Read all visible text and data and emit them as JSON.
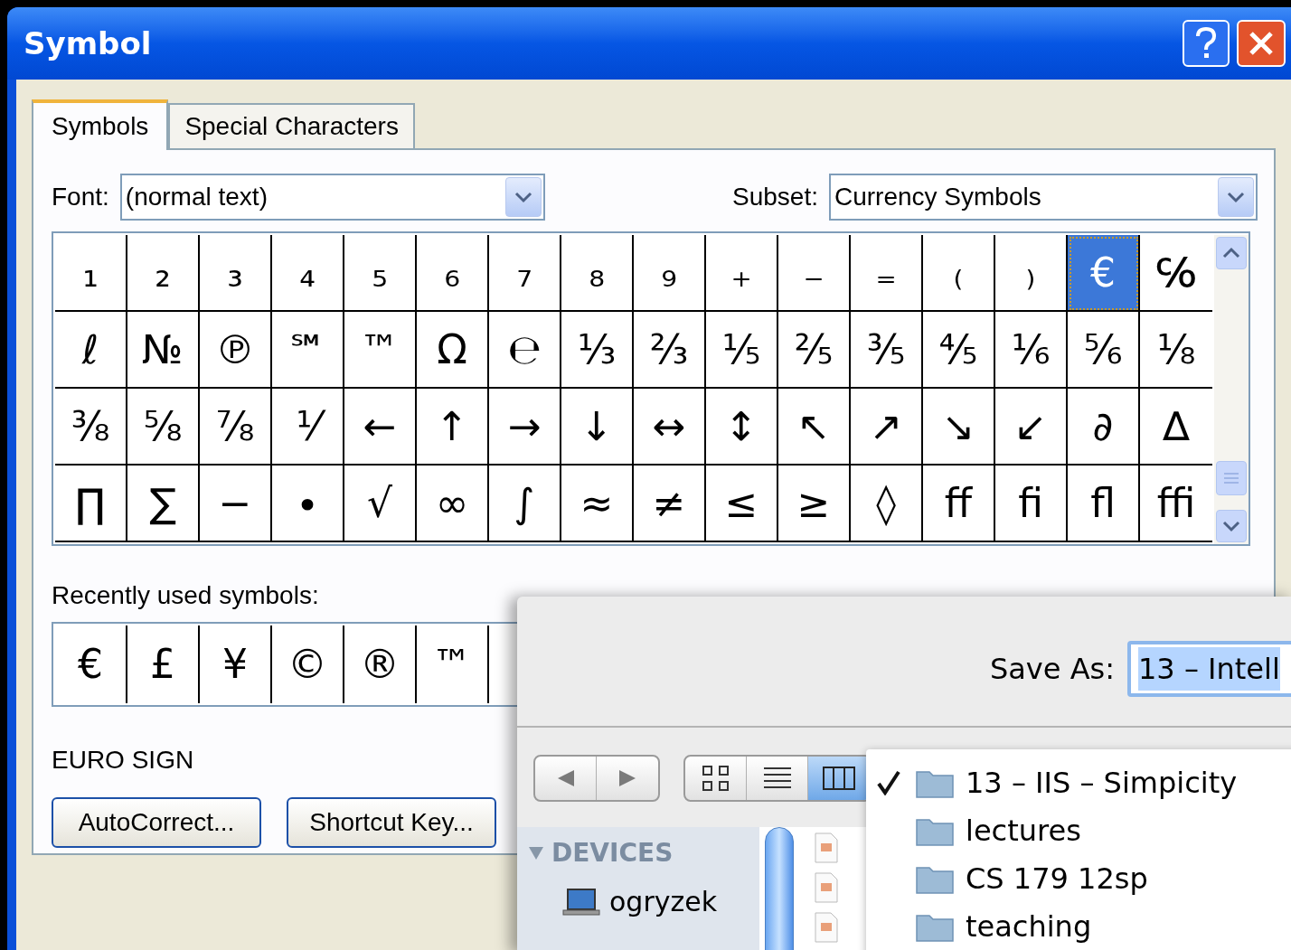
{
  "window": {
    "title": "Symbol"
  },
  "tabs": [
    {
      "label": "Symbols",
      "selected": true
    },
    {
      "label": "Special Characters",
      "selected": false
    }
  ],
  "font": {
    "label": "Font:",
    "value": "(normal text)"
  },
  "subset": {
    "label": "Subset:",
    "value": "Currency Symbols"
  },
  "grid": [
    [
      {
        "char": "₁",
        "selected": false
      },
      {
        "char": "₂",
        "selected": false
      },
      {
        "char": "₃",
        "selected": false
      },
      {
        "char": "₄",
        "selected": false
      },
      {
        "char": "₅",
        "selected": false
      },
      {
        "char": "₆",
        "selected": false
      },
      {
        "char": "₇",
        "selected": false
      },
      {
        "char": "₈",
        "selected": false
      },
      {
        "char": "₉",
        "selected": false
      },
      {
        "char": "₊",
        "selected": false
      },
      {
        "char": "₋",
        "selected": false
      },
      {
        "char": "₌",
        "selected": false
      },
      {
        "char": "₍",
        "selected": false
      },
      {
        "char": "₎",
        "selected": false
      },
      {
        "char": "€",
        "selected": true
      },
      {
        "char": "℅",
        "selected": false
      }
    ],
    [
      {
        "char": "ℓ",
        "selected": false
      },
      {
        "char": "№",
        "selected": false
      },
      {
        "char": "℗",
        "selected": false
      },
      {
        "char": "℠",
        "selected": false
      },
      {
        "char": "™",
        "selected": false
      },
      {
        "char": "Ω",
        "selected": false
      },
      {
        "char": "℮",
        "selected": false
      },
      {
        "char": "⅓",
        "selected": false
      },
      {
        "char": "⅔",
        "selected": false
      },
      {
        "char": "⅕",
        "selected": false
      },
      {
        "char": "⅖",
        "selected": false
      },
      {
        "char": "⅗",
        "selected": false
      },
      {
        "char": "⅘",
        "selected": false
      },
      {
        "char": "⅙",
        "selected": false
      },
      {
        "char": "⅚",
        "selected": false
      },
      {
        "char": "⅛",
        "selected": false
      }
    ],
    [
      {
        "char": "⅜",
        "selected": false
      },
      {
        "char": "⅝",
        "selected": false
      },
      {
        "char": "⅞",
        "selected": false
      },
      {
        "char": "⅟",
        "selected": false
      },
      {
        "char": "←",
        "selected": false
      },
      {
        "char": "↑",
        "selected": false
      },
      {
        "char": "→",
        "selected": false
      },
      {
        "char": "↓",
        "selected": false
      },
      {
        "char": "↔",
        "selected": false
      },
      {
        "char": "↕",
        "selected": false
      },
      {
        "char": "↖",
        "selected": false
      },
      {
        "char": "↗",
        "selected": false
      },
      {
        "char": "↘",
        "selected": false
      },
      {
        "char": "↙",
        "selected": false
      },
      {
        "char": "∂",
        "selected": false
      },
      {
        "char": "∆",
        "selected": false
      }
    ],
    [
      {
        "char": "∏",
        "selected": false
      },
      {
        "char": "∑",
        "selected": false
      },
      {
        "char": "−",
        "selected": false
      },
      {
        "char": "∙",
        "selected": false
      },
      {
        "char": "√",
        "selected": false
      },
      {
        "char": "∞",
        "selected": false
      },
      {
        "char": "∫",
        "selected": false
      },
      {
        "char": "≈",
        "selected": false
      },
      {
        "char": "≠",
        "selected": false
      },
      {
        "char": "≤",
        "selected": false
      },
      {
        "char": "≥",
        "selected": false
      },
      {
        "char": "◊",
        "selected": false
      },
      {
        "char": "ﬀ",
        "selected": false
      },
      {
        "char": "ﬁ",
        "selected": false
      },
      {
        "char": "ﬂ",
        "selected": false
      },
      {
        "char": "ﬃ",
        "selected": false
      }
    ]
  ],
  "recent": {
    "label": "Recently used symbols:",
    "symbols": [
      "€",
      "£",
      "¥",
      "©",
      "®",
      "™"
    ]
  },
  "description": "EURO SIGN",
  "buttons": [
    "AutoCorrect...",
    "Shortcut Key..."
  ],
  "save_dialog": {
    "save_as_label": "Save As:",
    "file_name": "13 – Intell",
    "view_buttons": [
      {
        "kind": "icons",
        "selected": false
      },
      {
        "kind": "list",
        "selected": false
      },
      {
        "kind": "columns",
        "selected": true
      }
    ],
    "sidebar_header": "DEVICES",
    "sidebar_items": [
      "ogryzek"
    ],
    "menu": [
      {
        "label": "13 – IIS – Simpicity",
        "checked": true
      },
      {
        "label": "lectures",
        "checked": false
      },
      {
        "label": "CS 179 12sp",
        "checked": false
      },
      {
        "label": "teaching",
        "checked": false
      }
    ]
  }
}
